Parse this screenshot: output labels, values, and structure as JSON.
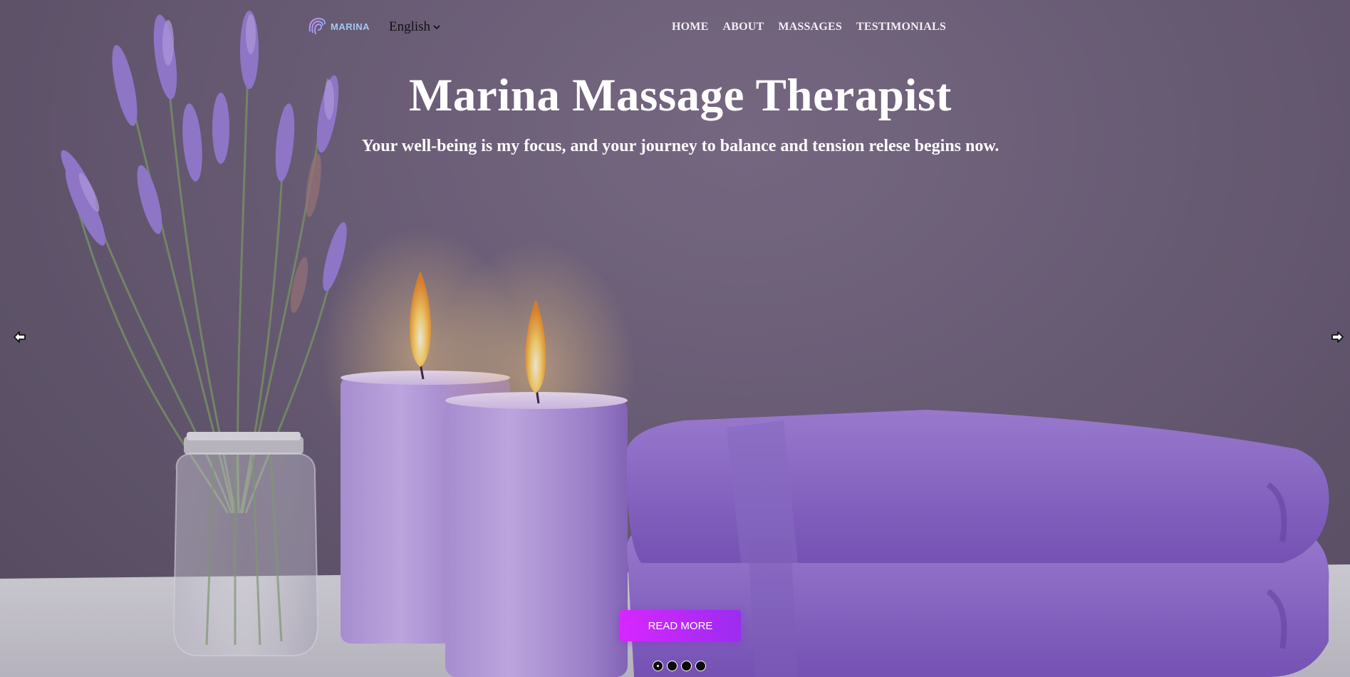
{
  "brand": {
    "logo_text": "MARINA",
    "logo_color": "#a3c9f0"
  },
  "language": {
    "selected": "English"
  },
  "nav": {
    "items": [
      "HOME",
      "ABOUT",
      "MASSAGES",
      "TESTIMONIALS"
    ]
  },
  "hero": {
    "title": "Marina Massage Therapist",
    "subtitle": "Your well-being is my focus, and your journey to balance and tension relese begins now.",
    "cta_label": "READ MORE",
    "cta_color_start": "#d826ff",
    "cta_color_end": "#9b2cf0"
  },
  "carousel": {
    "slide_count": 4,
    "active_index": 0
  },
  "icons": {
    "prev": "arrow-left-icon",
    "next": "arrow-right-icon",
    "language_chevron": "chevron-down-icon"
  }
}
